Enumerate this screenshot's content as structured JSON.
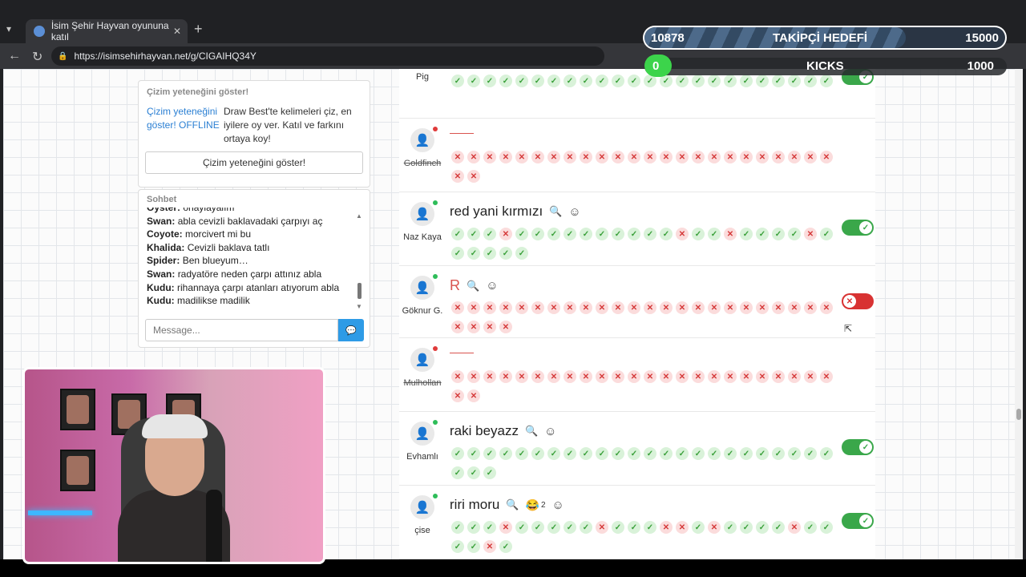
{
  "browser": {
    "tab_title": "İsim Şehir Hayvan oyununa katıl",
    "url": "https://isimsehirhayvan.net/g/CIGAIHQ34Y"
  },
  "draw_card": {
    "title": "Çizim yeteneğini göster!",
    "image_alt": "Çizim yeteneğini göster! OFFLINE",
    "description": "Draw Best'te kelimeleri çiz, en iyilere oy ver. Katıl ve farkını ortaya koy!",
    "button": "Çizim yeteneğini göster!"
  },
  "chat": {
    "title": "Sohbet",
    "messages": [
      {
        "user": "Oyster:",
        "text": "onaylayalım"
      },
      {
        "user": "Swan:",
        "text": "abla cevizli baklavadaki çarpıyı aç"
      },
      {
        "user": "Coyote:",
        "text": "morcivert mi bu"
      },
      {
        "user": "Khalida:",
        "text": "Cevizli baklava tatlı"
      },
      {
        "user": "Spider:",
        "text": "Ben blueyum…"
      },
      {
        "user": "Swan:",
        "text": "radyatöre neden çarpı attınız abla"
      },
      {
        "user": "Kudu:",
        "text": "rihannaya çarpı atanları atıyorum abla"
      },
      {
        "user": "Kudu:",
        "text": "madilikse madilik"
      }
    ],
    "placeholder": "Message..."
  },
  "rows": [
    {
      "player": "Pig",
      "answer": "",
      "votes": "vvvvvvvvvvvvvvvvvvvvvvvv",
      "toggle": "on"
    },
    {
      "player": "Goldfinch",
      "answer": "",
      "votes": "xxxxxxxxxxxxxxxxxxxxxxxxxx",
      "toggle": ""
    },
    {
      "player": "Naz Kaya",
      "answer": "red yani kırmızı",
      "votes": "vvvxvvvvvvvvvvxvvxvvvvxvvvvvv",
      "toggle": "on"
    },
    {
      "player": "Göknur G.",
      "answer": "R",
      "votes": "xxxxxxxxxxxxxxxxxxxxxxxxxxxx",
      "toggle": "off"
    },
    {
      "player": "Mulhollan",
      "answer": "",
      "votes": "xxxxxxxxxxxxxxxxxxxxxxxxxx",
      "toggle": ""
    },
    {
      "player": "Evhamlı",
      "answer": "raki beyazz",
      "votes": "vvvvvvvvvvvvvvvvvvvvvvvvvvv",
      "toggle": "on"
    },
    {
      "player": "çise",
      "answer": "riri moru",
      "reaction_count": "2",
      "votes": "vvvxvvvvvxvvvxxvxvvvvxvvvvxv",
      "toggle": "on"
    }
  ],
  "goal": {
    "current": "10878",
    "label": "TAKİPÇİ HEDEFİ",
    "target": "15000",
    "progress": 0.725
  },
  "kicks": {
    "current": "0",
    "label": "KICKS",
    "target": "1000",
    "progress": 0.0
  },
  "icons": {
    "search": "magnifier-icon",
    "emoji": "smile-icon",
    "send": "send-icon"
  },
  "colors": {
    "ok": "#3aa03a",
    "no": "#d53a3a",
    "toggle_on": "#3aa74a",
    "toggle_off": "#d83232",
    "accent": "#2e9be6"
  }
}
